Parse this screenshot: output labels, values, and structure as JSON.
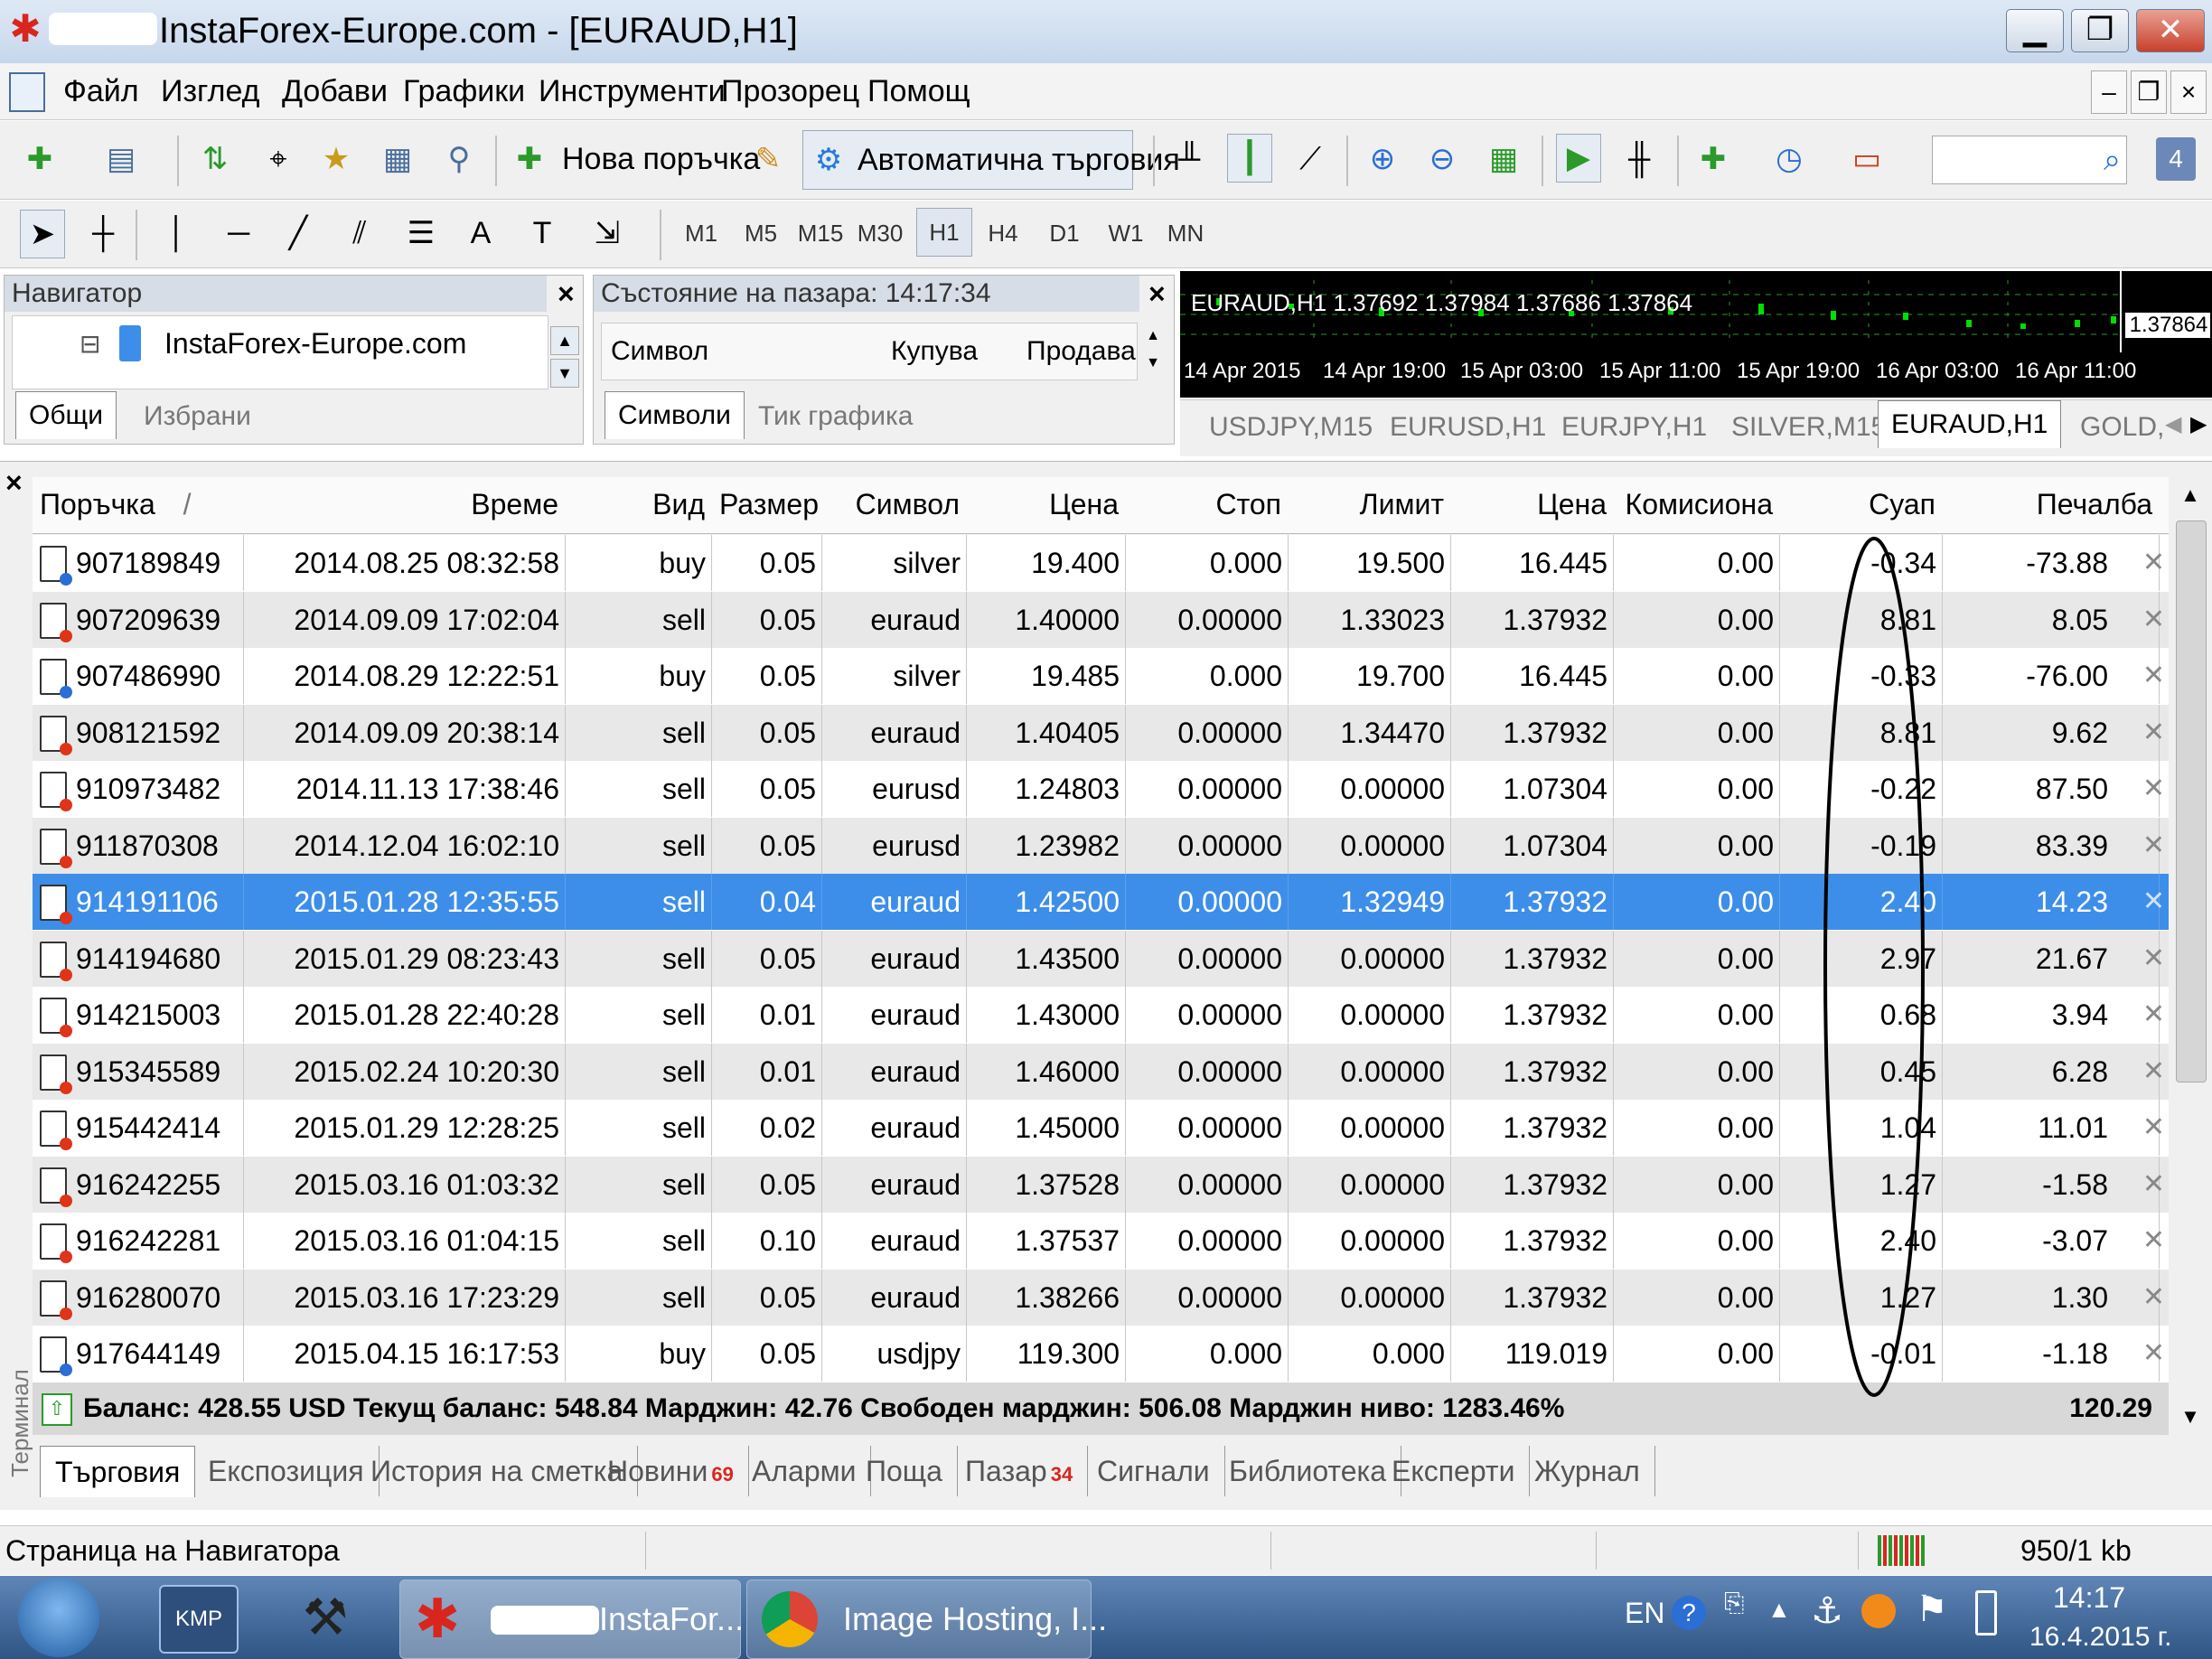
{
  "window": {
    "title": "InstaForex-Europe.com - [EURAUD,H1]",
    "minimize": "▁",
    "maximize": "❐",
    "close": "✕",
    "doc_minimize": "‒",
    "doc_restore": "❐",
    "doc_close": "×"
  },
  "menu": [
    "Файл",
    "Изглед",
    "Добави",
    "Графики",
    "Инструменти",
    "Прозорец",
    "Помощ"
  ],
  "toolbar": {
    "new_order": "Нова поръчка",
    "auto_trading": "Автоматична търговия",
    "notification_count": "4"
  },
  "timeframes": [
    "M1",
    "M5",
    "M15",
    "M30",
    "H1",
    "H4",
    "D1",
    "W1",
    "MN"
  ],
  "navigator": {
    "title": "Навигатор",
    "close": "×",
    "tree_item": "InstaForex-Europe.com",
    "tabs": [
      "Общи",
      "Избрани"
    ]
  },
  "market_watch": {
    "title": "Състояние на пазара: 14:17:34",
    "close": "×",
    "columns": [
      "Символ",
      "Купува",
      "Продава"
    ],
    "tabs": [
      "Символи",
      "Тик графика"
    ]
  },
  "chart": {
    "header": "EURAUD,H1  1.37692 1.37984 1.37686 1.37864",
    "price_label": "1.37864",
    "time_labels": [
      "14 Apr 2015",
      "14 Apr 19:00",
      "15 Apr 03:00",
      "15 Apr 11:00",
      "15 Apr 19:00",
      "16 Apr 03:00",
      "16 Apr 11:00"
    ],
    "tabs": [
      "USDJPY,M15",
      "EURUSD,H1",
      "EURJPY,H1",
      "SILVER,M15",
      "EURAUD,H1",
      "GOLD,"
    ],
    "active_tab": "EURAUD,H1"
  },
  "terminal": {
    "side_label": "Терминал",
    "close": "×",
    "columns": [
      "Поръчка",
      "Време",
      "Вид",
      "Размер",
      "Символ",
      "Цена",
      "Стоп",
      "Лимит",
      "Цена",
      "Комисиона",
      "Суап",
      "Печалба"
    ],
    "sort_indicator": "/",
    "orders": [
      [
        "907189849",
        "2014.08.25 08:32:58",
        "buy",
        "0.05",
        "silver",
        "19.400",
        "0.000",
        "19.500",
        "16.445",
        "0.00",
        "-0.34",
        "-73.88"
      ],
      [
        "907209639",
        "2014.09.09 17:02:04",
        "sell",
        "0.05",
        "euraud",
        "1.40000",
        "0.00000",
        "1.33023",
        "1.37932",
        "0.00",
        "8.81",
        "8.05"
      ],
      [
        "907486990",
        "2014.08.29 12:22:51",
        "buy",
        "0.05",
        "silver",
        "19.485",
        "0.000",
        "19.700",
        "16.445",
        "0.00",
        "-0.33",
        "-76.00"
      ],
      [
        "908121592",
        "2014.09.09 20:38:14",
        "sell",
        "0.05",
        "euraud",
        "1.40405",
        "0.00000",
        "1.34470",
        "1.37932",
        "0.00",
        "8.81",
        "9.62"
      ],
      [
        "910973482",
        "2014.11.13 17:38:46",
        "sell",
        "0.05",
        "eurusd",
        "1.24803",
        "0.00000",
        "0.00000",
        "1.07304",
        "0.00",
        "-0.22",
        "87.50"
      ],
      [
        "911870308",
        "2014.12.04 16:02:10",
        "sell",
        "0.05",
        "eurusd",
        "1.23982",
        "0.00000",
        "0.00000",
        "1.07304",
        "0.00",
        "-0.19",
        "83.39"
      ],
      [
        "914191106",
        "2015.01.28 12:35:55",
        "sell",
        "0.04",
        "euraud",
        "1.42500",
        "0.00000",
        "1.32949",
        "1.37932",
        "0.00",
        "2.40",
        "14.23"
      ],
      [
        "914194680",
        "2015.01.29 08:23:43",
        "sell",
        "0.05",
        "euraud",
        "1.43500",
        "0.00000",
        "0.00000",
        "1.37932",
        "0.00",
        "2.97",
        "21.67"
      ],
      [
        "914215003",
        "2015.01.28 22:40:28",
        "sell",
        "0.01",
        "euraud",
        "1.43000",
        "0.00000",
        "0.00000",
        "1.37932",
        "0.00",
        "0.68",
        "3.94"
      ],
      [
        "915345589",
        "2015.02.24 10:20:30",
        "sell",
        "0.01",
        "euraud",
        "1.46000",
        "0.00000",
        "0.00000",
        "1.37932",
        "0.00",
        "0.45",
        "6.28"
      ],
      [
        "915442414",
        "2015.01.29 12:28:25",
        "sell",
        "0.02",
        "euraud",
        "1.45000",
        "0.00000",
        "0.00000",
        "1.37932",
        "0.00",
        "1.04",
        "11.01"
      ],
      [
        "916242255",
        "2015.03.16 01:03:32",
        "sell",
        "0.05",
        "euraud",
        "1.37528",
        "0.00000",
        "0.00000",
        "1.37932",
        "0.00",
        "1.27",
        "-1.58"
      ],
      [
        "916242281",
        "2015.03.16 01:04:15",
        "sell",
        "0.10",
        "euraud",
        "1.37537",
        "0.00000",
        "0.00000",
        "1.37932",
        "0.00",
        "2.40",
        "-3.07"
      ],
      [
        "916280070",
        "2015.03.16 17:23:29",
        "sell",
        "0.05",
        "euraud",
        "1.38266",
        "0.00000",
        "0.00000",
        "1.37932",
        "0.00",
        "1.27",
        "1.30"
      ],
      [
        "917644149",
        "2015.04.15 16:17:53",
        "buy",
        "0.05",
        "usdjpy",
        "119.300",
        "0.000",
        "0.000",
        "119.019",
        "0.00",
        "-0.01",
        "-1.18"
      ]
    ],
    "selected_row": 6,
    "summary": "Баланс: 428.55 USD  Текущ баланс: 548.84  Марджин: 42.76  Свободен марджин: 506.08  Марджин ниво: 1283.46%",
    "summary_total": "120.29",
    "tabs": [
      {
        "label": "Търговия",
        "badge": ""
      },
      {
        "label": "Експозиция",
        "badge": ""
      },
      {
        "label": "История на сметка",
        "badge": ""
      },
      {
        "label": "Новини",
        "badge": "69"
      },
      {
        "label": "Аларми",
        "badge": ""
      },
      {
        "label": "Поща",
        "badge": ""
      },
      {
        "label": "Пазар",
        "badge": "34"
      },
      {
        "label": "Сигнали",
        "badge": ""
      },
      {
        "label": "Библиотека",
        "badge": ""
      },
      {
        "label": "Експерти",
        "badge": ""
      },
      {
        "label": "Журнал",
        "badge": ""
      }
    ]
  },
  "status": {
    "left": "Страница на Навигатора",
    "traffic": "950/1 kb"
  },
  "taskbar": {
    "kmp": "KMP",
    "app1": "InstaFor...",
    "app2": "Image Hosting, I...",
    "lang": "EN",
    "time": "14:17",
    "date": "16.4.2015 г."
  },
  "colors": {
    "selection": "#3d8ee8",
    "sell_dot": "#e0341a",
    "buy_dot": "#2b6ed6",
    "annotation_ellipse": "#000000"
  }
}
